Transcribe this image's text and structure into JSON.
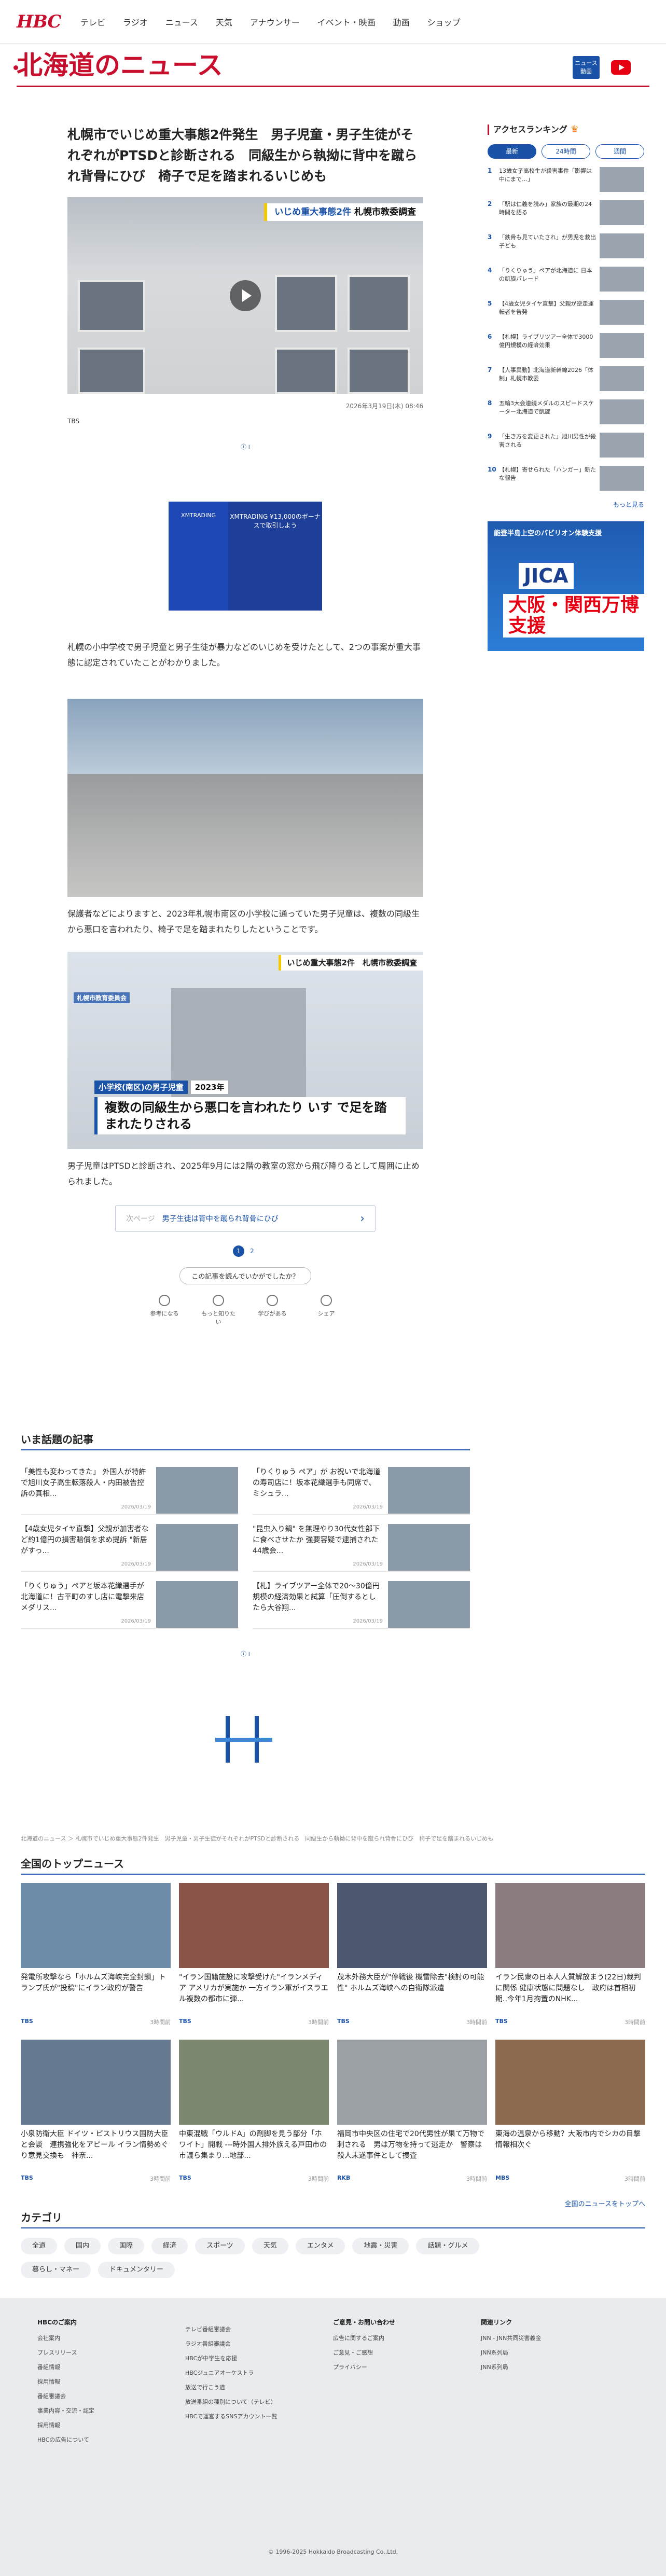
{
  "header": {
    "logo": "HBC",
    "nav": [
      "テレビ",
      "ラジオ",
      "ニュース",
      "天気",
      "アナウンサー",
      "イベント・映画",
      "動画",
      "ショップ"
    ]
  },
  "section": {
    "title": "北海道のニュース",
    "news_badge": "ニュース 動画"
  },
  "article": {
    "title": "札幌市でいじめ重大事態2件発生　男子児童・男子生徒がそれぞれがPTSDと診断される　同級生から執拗に背中を蹴られ背骨にひび　椅子で足を踏まれるいじめも",
    "photo_tag_main": "いじめ重大事態2件",
    "photo_tag_sub": "札幌市教委調査",
    "date": "2026年3月19日(木) 08:46",
    "source": "TBS",
    "p1": "札幌の小中学校で男子児童と男子生徒が暴力などのいじめを受けたとして、2つの事案が重大事態に認定されていたことがわかりました。",
    "p2": "保護者などによりますと、2023年札幌市南区の小学校に通っていた男子児童は、複数の同級生から悪口を言われたり、椅子で足を踏まれたりしたということです。",
    "caption_tag": "いじめ重大事態2件　札幌市教委調査",
    "caption_school": "小学校(南区)の男子児童",
    "caption_year": "2023年",
    "caption_big": "複数の同級生から悪口を言われたり いす で足を踏まれたりされる",
    "caption_side": "札幌市教育委員会",
    "p3": "男子児童はPTSDと診断され、2025年9月には2階の教室の窓から飛び降りるとして周囲に止められました。",
    "ad_note": "広告",
    "ad_left": "XMTRADING",
    "ad_right": "XMTRADING ¥13,000のボーナスで取引しよう",
    "next_label": "次ページ",
    "next_text": "男子生徒は背中を蹴られ背骨にひび",
    "pages": [
      "1",
      "2"
    ],
    "feedback_q": "この記事を読んでいかがでしたか？",
    "feedback": [
      "参考になる",
      "もっと知りたい",
      "学びがある",
      "シェア"
    ]
  },
  "ranking": {
    "title": "アクセスランキング",
    "tabs": [
      "最新",
      "24時間",
      "週間"
    ],
    "items": [
      {
        "n": "1",
        "t": "13歳女子高校生が殺害事件「影響は中にまで…」"
      },
      {
        "n": "2",
        "t": "「駅は仁義を読み」家族の最期の24時間を語る"
      },
      {
        "n": "3",
        "t": "「鉄骨も見ていたされ」が男児を救出 子ども"
      },
      {
        "n": "4",
        "t": "「りくりゅう」ペアが北海道に 日本の凱旋パレード"
      },
      {
        "n": "5",
        "t": "【4歳女児タイヤ直撃】父親が逆走運転者を告発"
      },
      {
        "n": "6",
        "t": "【札幌】ライブリツアー全体で3000億円規模の経済効果"
      },
      {
        "n": "7",
        "t": "【人事異動】北海道新幹線2026「体制」札幌市教委"
      },
      {
        "n": "8",
        "t": "五輪3大会連続メダルのスピードスケーター北海道で凱旋"
      },
      {
        "n": "9",
        "t": "「生き方を変更された」旭川男性が殺害される"
      },
      {
        "n": "10",
        "t": "【札幌】寄せられた「ハンガー」新たな報告"
      }
    ],
    "more": "もっと見る"
  },
  "jica": {
    "top": "能登半島上空のパビリオン体験支援",
    "line1": "JICA",
    "line2": "大阪・関西万博支援"
  },
  "topics": {
    "title": "いま話題の記事",
    "items": [
      {
        "t": "「美性も変わってきた」 外国人が特許で旭川女子高生転落殺人・内田被告控訴の真相...",
        "d": "2026/03/19"
      },
      {
        "t": "「りくりゅう ペア」が お祝いで北海道の寿司店に！坂本花織選手も同席で、ミシュラ...",
        "d": "2026/03/19"
      },
      {
        "t": "【4歳女児タイヤ直撃】父親が加害者など約1億円の損害賠償を求め提訴 \"新居がすっ...",
        "d": "2026/03/19"
      },
      {
        "t": "\"昆虫入り鍋\" を無理やり30代女性部下に食べさせたか 強要容疑で逮捕された44歳会...",
        "d": "2026/03/19"
      },
      {
        "t": "「りくりゅう」ペアと坂本花織選手が北海道に！古平町のすし店に電撃来店メダリス...",
        "d": "2026/03/19"
      },
      {
        "t": "【札】ライブツアー全体で20～30億円規模の経済効果と試算「圧倒するとしたら大谷翔...",
        "d": "2026/03/19"
      }
    ]
  },
  "breadcrumb": "北海道のニュース ＞ 札幌市でいじめ重大事態2件発生　男子児童・男子生徒がそれぞれがPTSDと診断される　同級生から執拗に背中を蹴られ背骨にひび　椅子で足を踏まれるいじめも",
  "national": {
    "title": "全国のトップニュース",
    "items": [
      {
        "t": "発電所攻撃なら「ホルムズ海峡完全封鎖」トランプ氏が\"投稿\"にイラン政府が警告",
        "s": "TBS",
        "d": "3時間前"
      },
      {
        "t": "\"イラン国籍施設に攻撃受けた\"イランメディア アメリカが実施か 一方イラン軍がイスラエル複数の都市に弾...",
        "s": "TBS",
        "d": "3時間前"
      },
      {
        "t": "茂木外務大臣が\"停戦後 機雷除去\"検討の可能性\" ホルムズ海峡への自衛隊派遣",
        "s": "TBS",
        "d": "3時間前"
      },
      {
        "t": "イラン民衆の日本人人質解放まう(22日)裁判に関係 健康状態に問題なし　政府は首相初期..今年1月拘置のNHK...",
        "s": "TBS",
        "d": "3時間前"
      },
      {
        "t": "小泉防衛大臣 ドイツ・ピストリウス国防大臣と会談　連携強化をアピール イラン情勢めぐり意見交換も　神奈...",
        "s": "TBS",
        "d": "3時間前"
      },
      {
        "t": "中東混戦「ウルドA」の剤脚を見う部分「ホワイト」開戦 ---時外国人排外族える戸田市の市議ら集まり...地部...",
        "s": "TBS",
        "d": "3時間前"
      },
      {
        "t": "福岡市中央区の住宅で20代男性が果て万物で刺される　男は万物を持って逃走か　警察は殺人未遂事件として捜査",
        "s": "RKB",
        "d": "3時間前"
      },
      {
        "t": "東海の温泉から移動？大阪市内でシカの目撃情報相次ぐ",
        "s": "MBS",
        "d": "3時間前"
      }
    ],
    "all": "全国のニュースをトップへ"
  },
  "categories": {
    "title": "カテゴリ",
    "items": [
      "全道",
      "国内",
      "国際",
      "経済",
      "スポーツ",
      "天気",
      "エンタメ",
      "地震・災害",
      "話題・グルメ",
      "暮らし・マネー",
      "ドキュメンタリー"
    ]
  },
  "footer": {
    "cols": [
      {
        "h": "HBCのご案内",
        "items": [
          "会社案内",
          "プレスリリース",
          "番組情報",
          "採用情報",
          "番組審議会",
          "事業内容・交流・認定",
          "採用情報",
          "HBCの広告について"
        ]
      },
      {
        "h": "",
        "items": [
          "テレビ番組審議会",
          "ラジオ番組審議会",
          "HBCが中学生を応援",
          "HBCジュニアオーケストラ",
          "放送で行こう道",
          "放送番組の種別について（テレビ）",
          "HBCで運営するSNSアカウント一覧"
        ]
      },
      {
        "h": "ご意見・お問い合わせ",
        "items": [
          "広告に関するご案内",
          "ご意見・ご感想",
          "プライバシー"
        ]
      },
      {
        "h": "関連リンク",
        "items": [
          "JNN - JNN共同災害義金",
          "JNN系列局",
          "JNN系列局"
        ]
      }
    ],
    "copyright": "© 1996-2025 Hokkaido Broadcasting Co.,Ltd."
  }
}
